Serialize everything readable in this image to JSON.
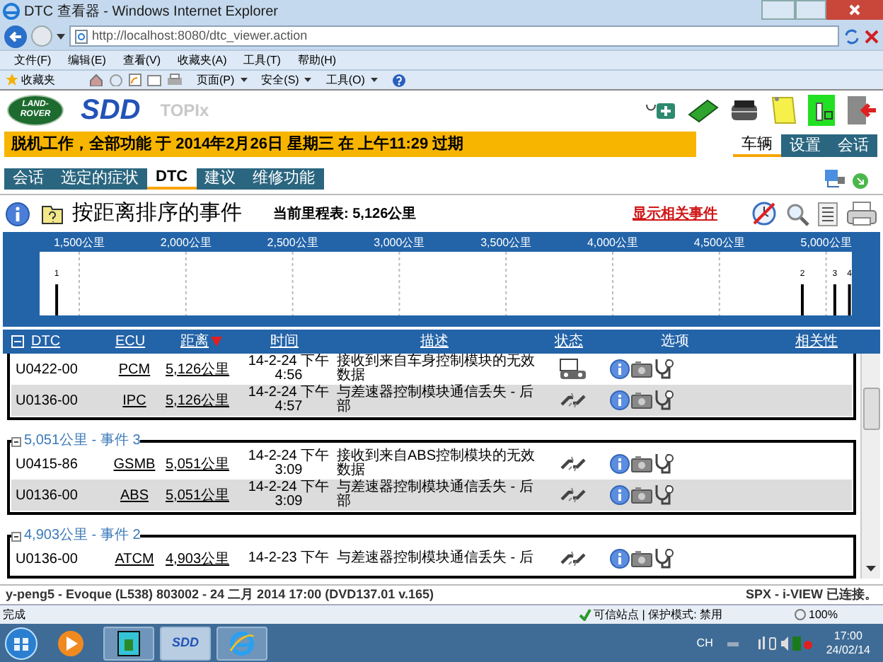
{
  "window": {
    "title": "DTC 查看器 - Windows Internet Explorer"
  },
  "address_bar": {
    "url": "http://localhost:8080/dtc_viewer.action"
  },
  "menu_bar": [
    "文件(F)",
    "编辑(E)",
    "查看(V)",
    "收藏夹(A)",
    "工具(T)",
    "帮助(H)"
  ],
  "favorites_bar": {
    "label": "收藏夹",
    "commands": [
      "页面(P)",
      "安全(S)",
      "工具(O)"
    ]
  },
  "app_header": {
    "logo_lines": [
      "LAND-",
      "ROVER"
    ],
    "brand": "SDD",
    "product": "TOPIx"
  },
  "warning_bar": "脱机工作，全部功能 于 2014年2月26日 星期三 在 上午11:29 过期",
  "right_tabs": [
    {
      "label": "车辆",
      "selected": true
    },
    {
      "label": "设置",
      "selected": false
    },
    {
      "label": "会话",
      "selected": false
    }
  ],
  "tabs": [
    {
      "label": "会话",
      "selected": false
    },
    {
      "label": "选定的症状",
      "selected": false
    },
    {
      "label": "DTC",
      "selected": true
    },
    {
      "label": "建议",
      "selected": false
    },
    {
      "label": "维修功能",
      "selected": false
    }
  ],
  "heading": {
    "title": "按距离排序的事件",
    "odometer": "当前里程表: 5,126公里",
    "link": "显示相关事件"
  },
  "timeline": {
    "scale_labels": [
      "1,500公里",
      "2,000公里",
      "2,500公里",
      "3,000公里",
      "3,500公里",
      "4,000公里",
      "4,500公里",
      "5,000公里"
    ],
    "events": [
      {
        "label": "1",
        "level": 0.021
      },
      {
        "label": "2",
        "level": 0.939
      },
      {
        "label": "3",
        "level": 0.979
      },
      {
        "label": "4",
        "level": 0.997
      }
    ]
  },
  "table": {
    "columns": [
      {
        "label": "DTC",
        "sorted": false
      },
      {
        "label": "ECU",
        "sorted": false
      },
      {
        "label": "距离",
        "sorted": true
      },
      {
        "label": "时间",
        "sorted": false
      },
      {
        "label": "描述",
        "sorted": false
      },
      {
        "label": "状态",
        "sorted": false
      },
      {
        "label": "选项",
        "sorted": false
      },
      {
        "label": "相关性",
        "sorted": false
      }
    ],
    "groups": [
      {
        "rows": [
          {
            "dtc": "U0422-00",
            "ecu": "PCM",
            "distance": "5,126公里",
            "time": "14-2-24 下午 4:56",
            "description": "接收到来自车身控制模块的无效数据",
            "kind": "module",
            "selected": false
          },
          {
            "dtc": "U0136-00",
            "ecu": "IPC",
            "distance": "5,126公里",
            "time": "14-2-24 下午 4:57",
            "description": "与差速器控制模块通信丢失 - 后部",
            "kind": "link",
            "selected": true
          }
        ]
      },
      {
        "legend": "5,051公里 - 事件 3",
        "expanded": true,
        "rows": [
          {
            "dtc": "U0415-86",
            "ecu": "GSMB",
            "distance": "5,051公里",
            "time": "14-2-24 下午 3:09",
            "description": "接收到来自ABS控制模块的无效数据",
            "kind": "link",
            "selected": false
          },
          {
            "dtc": "U0136-00",
            "ecu": "ABS",
            "distance": "5,051公里",
            "time": "14-2-24 下午 3:09",
            "description": "与差速器控制模块通信丢失 - 后部",
            "kind": "link",
            "selected": true
          }
        ]
      },
      {
        "legend": "4,903公里 - 事件 2",
        "expanded": true,
        "rows": [
          {
            "dtc": "U0136-00",
            "ecu": "ATCM",
            "distance": "4,903公里",
            "time": "14-2-23 下午",
            "description": "与差速器控制模块通信丢失 - 后",
            "kind": "link",
            "selected": false
          }
        ]
      }
    ]
  },
  "app_status": {
    "left": "y-peng5 - Evoque (L538) 803002 - 24 二月 2014 17:00 (DVD137.01 v.165)",
    "right": "SPX - i-VIEW 已连接。"
  },
  "ie_status": {
    "left": "完成",
    "zone": "可信站点 | 保护模式: 禁用",
    "zoom": "100%"
  },
  "taskbar": {
    "app_label": "SDD",
    "language": "CH",
    "time": "17:00",
    "date": "24/02/14"
  }
}
